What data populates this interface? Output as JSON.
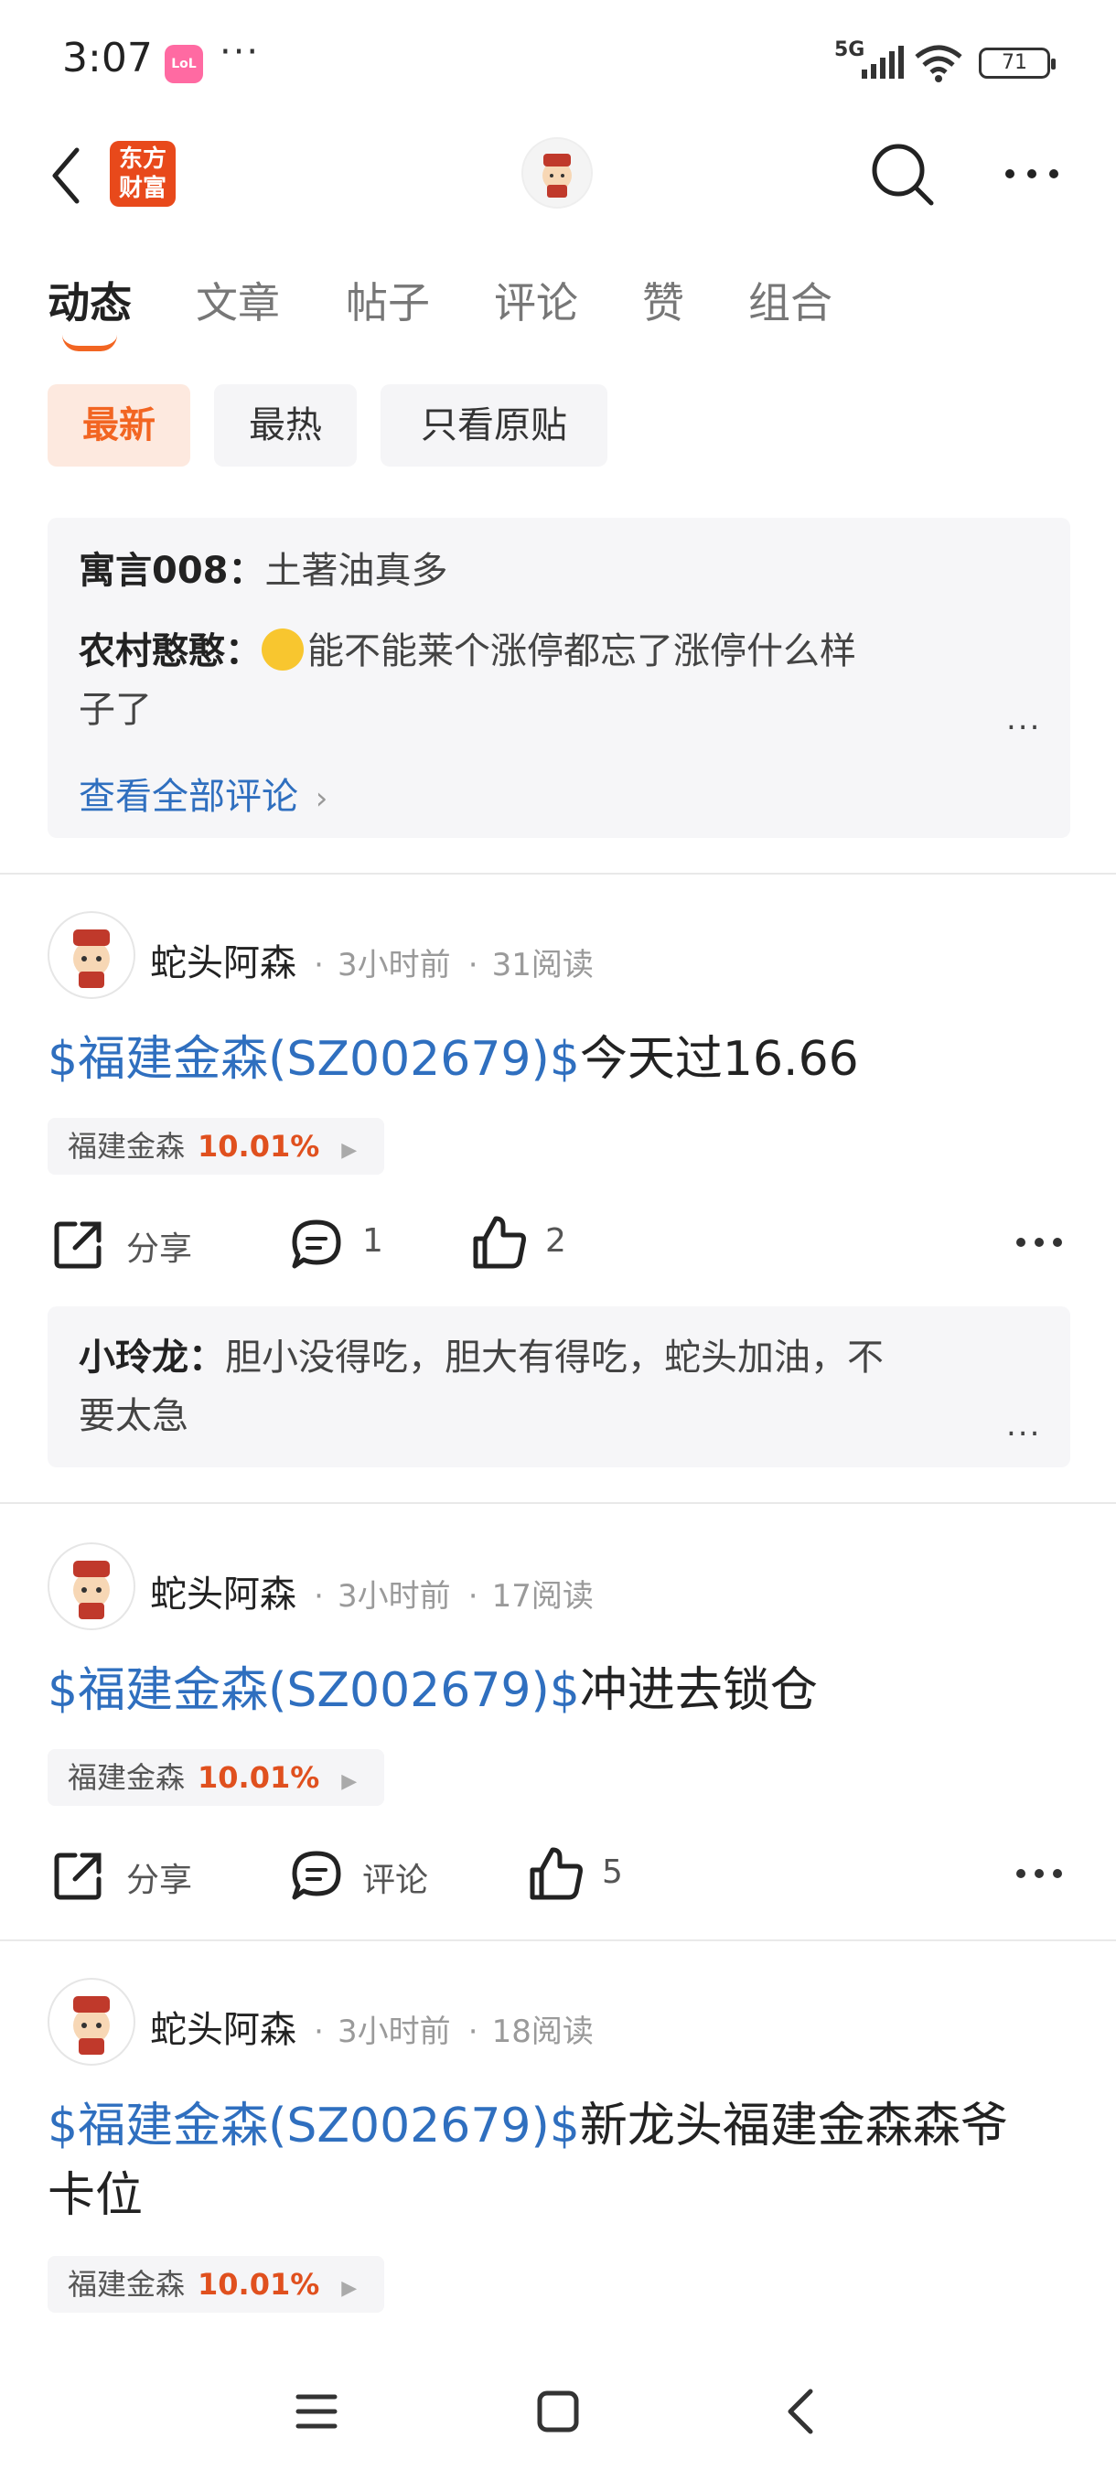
{
  "status_bar": {
    "time": "3:07",
    "app_badge": "LoL",
    "more": "···",
    "network": "5G",
    "battery": "71"
  },
  "header": {
    "logo_text_line1": "东方",
    "logo_text_line2": "财富"
  },
  "tabs": [
    {
      "label": "动态",
      "active": true
    },
    {
      "label": "文章"
    },
    {
      "label": "帖子"
    },
    {
      "label": "评论"
    },
    {
      "label": "赞"
    },
    {
      "label": "组合"
    }
  ],
  "filters": [
    {
      "label": "最新",
      "active": true
    },
    {
      "label": "最热"
    },
    {
      "label": "只看原贴"
    }
  ],
  "top_comments": {
    "items": [
      {
        "user": "寓言008：",
        "text": "土著油真多"
      },
      {
        "user": "农村憨憨：",
        "text_line1": "能不能莱个涨停都忘了涨停什么样",
        "text_line2": "子了"
      }
    ],
    "more": "...",
    "view_all": "查看全部评论"
  },
  "posts": [
    {
      "author": "蛇头阿森",
      "time": "3小时前",
      "reads": "31阅读",
      "ticker": "$福建金森(SZ002679)$",
      "text": "今天过16.66",
      "stock_name": "福建金森",
      "stock_pct": "10.01%",
      "share_label": "分享",
      "comment_label": "1",
      "like_count": "2",
      "reply": {
        "user": "小玲龙：",
        "text_line1": "胆小没得吃，胆大有得吃，蛇头加油，不",
        "text_line2": "要太急",
        "more": "..."
      }
    },
    {
      "author": "蛇头阿森",
      "time": "3小时前",
      "reads": "17阅读",
      "ticker": "$福建金森(SZ002679)$",
      "text": "冲进去锁仓",
      "stock_name": "福建金森",
      "stock_pct": "10.01%",
      "share_label": "分享",
      "comment_label": "评论",
      "like_count": "5"
    },
    {
      "author": "蛇头阿森",
      "time": "3小时前",
      "reads": "18阅读",
      "ticker": "$福建金森(SZ002679)$",
      "text_line1": "新龙头福建金森森爷",
      "text_line2": "卡位",
      "stock_name": "福建金森",
      "stock_pct": "10.01%"
    }
  ],
  "meta_sep": "·",
  "colors": {
    "accent": "#f26522",
    "link": "#2f6fbf",
    "up": "#e0501e"
  }
}
